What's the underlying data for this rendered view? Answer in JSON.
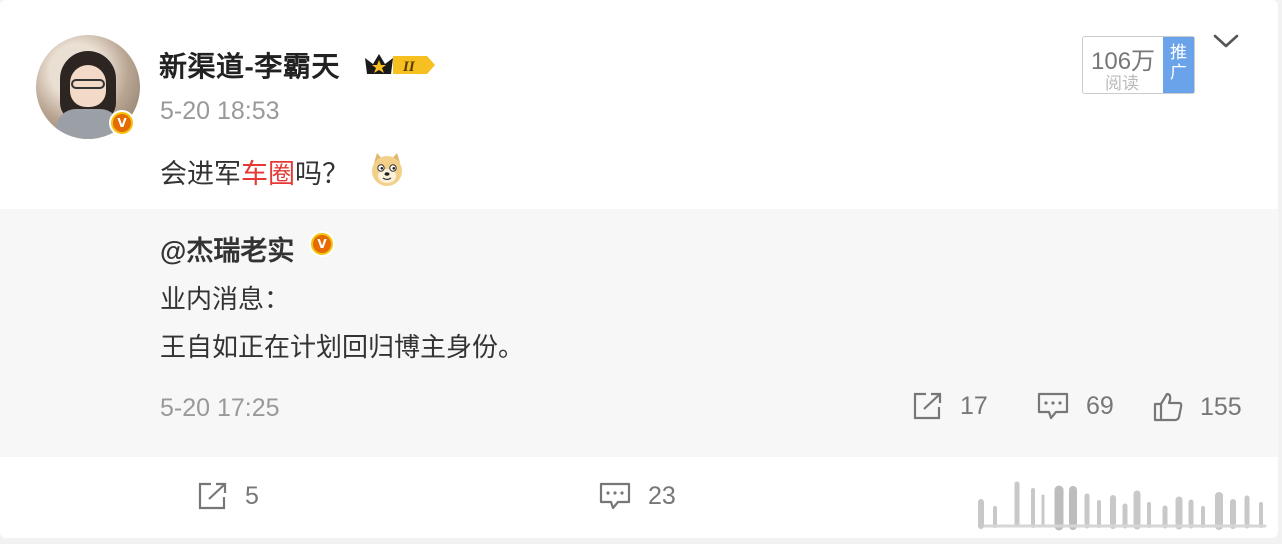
{
  "post": {
    "author": "新渠道-李霸天",
    "level": "II",
    "time": "5-20 18:53",
    "text_before": "会进军",
    "text_link": "车圈",
    "text_after": "吗？",
    "reads_num": "106万",
    "reads_label": "阅读",
    "promo_label": "推广"
  },
  "quote": {
    "author": "@杰瑞老实",
    "line1": "业内消息：",
    "line2": "王自如正在计划回归博主身份。",
    "time": "5-20 17:25",
    "reposts": "17",
    "comments": "69",
    "likes": "155"
  },
  "footer": {
    "reposts": "5",
    "comments": "23"
  },
  "icons": {
    "verified": "v-badge-icon",
    "emoji": "doge-emoji-icon",
    "more": "chevron-down-icon",
    "repost": "share-icon",
    "comment": "comment-icon",
    "like": "thumbs-up-icon"
  },
  "colors": {
    "link": "#e53935",
    "promo": "#6aa3ea",
    "badge": "#f2c40d"
  }
}
